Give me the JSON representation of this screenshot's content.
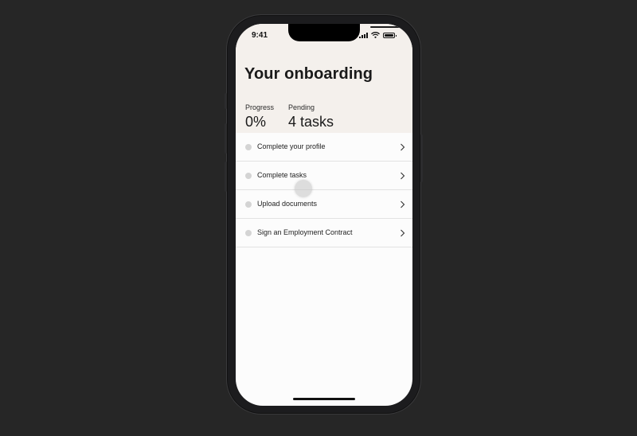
{
  "status_bar": {
    "time": "9:41"
  },
  "header": {
    "title": "Your onboarding",
    "background_color": "#f4f0ec"
  },
  "stats": {
    "progress_label": "Progress",
    "progress_value": "0%",
    "pending_label": "Pending",
    "pending_value": "4 tasks"
  },
  "tasks": [
    {
      "label": "Complete your profile",
      "icon": "clock-icon"
    },
    {
      "label": "Complete tasks",
      "icon": "clock-icon"
    },
    {
      "label": "Upload documents",
      "icon": "clock-icon"
    },
    {
      "label": "Sign an Employment Contract",
      "icon": "clock-icon"
    }
  ],
  "colors": {
    "background": "#262626",
    "screen": "#fcfcfc"
  }
}
